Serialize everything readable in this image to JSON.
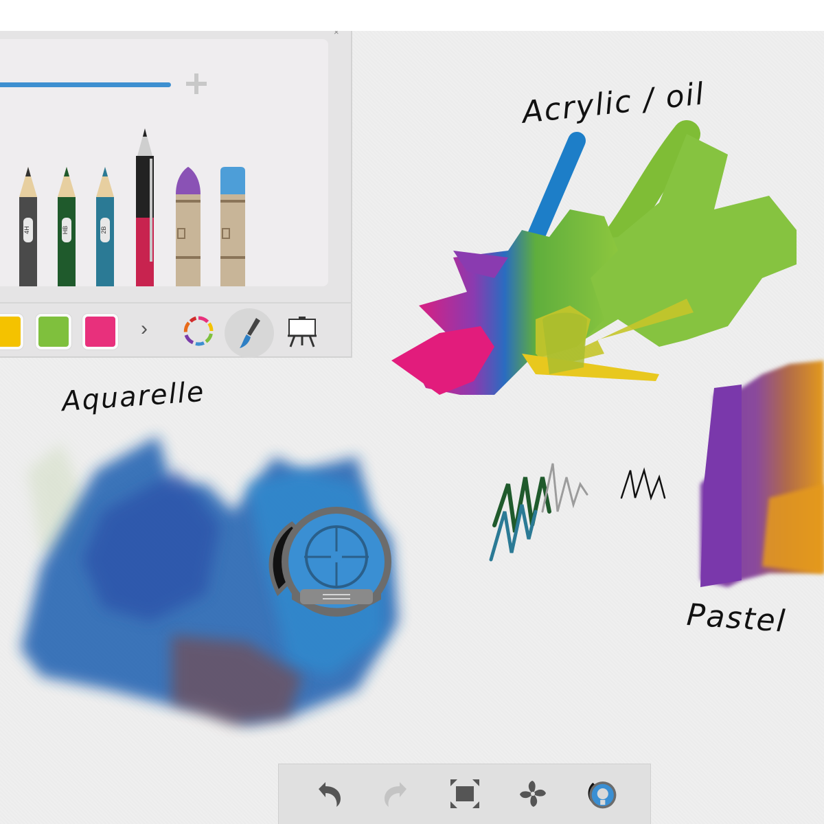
{
  "canvas": {
    "labels": {
      "acrylic_oil": "Acrylic / oil",
      "aquarelle": "Aquarelle",
      "pastel": "Pastel"
    }
  },
  "tool_panel": {
    "pencils": [
      {
        "name": "pencil-4h",
        "grade": "4H",
        "color": "#4a4a4a"
      },
      {
        "name": "pencil-hb",
        "grade": "HB",
        "color": "#1f5a2c"
      },
      {
        "name": "pencil-2b",
        "grade": "2B",
        "color": "#2b7a95"
      }
    ],
    "tools": [
      {
        "name": "pen",
        "icon": "ballpoint-pen-icon",
        "color": "#c8234f"
      },
      {
        "name": "crayon-purple",
        "icon": "crayon-icon",
        "color": "#8a52b5"
      },
      {
        "name": "crayon-blue",
        "icon": "crayon-icon",
        "color": "#4d9ed8"
      }
    ],
    "swatches": [
      {
        "name": "yellow",
        "color": "#f4c200"
      },
      {
        "name": "green",
        "color": "#7fc03d"
      },
      {
        "name": "pink",
        "color": "#e8307c"
      }
    ],
    "more_chevron": "›",
    "icons": {
      "color_wheel": "color-wheel-icon",
      "brush": "brush-icon",
      "easel": "easel-icon",
      "plus": "plus-icon",
      "close": "close-icon"
    },
    "close_glyph": "×",
    "stroke_width_color": "#3d8fd0"
  },
  "bottom_toolbar": {
    "buttons": [
      {
        "name": "undo",
        "icon": "undo-icon"
      },
      {
        "name": "redo",
        "icon": "redo-icon"
      },
      {
        "name": "fit-screen",
        "icon": "fit-screen-icon"
      },
      {
        "name": "fan",
        "icon": "fan-icon"
      },
      {
        "name": "ruler",
        "icon": "ruler-icon"
      }
    ]
  },
  "colors": {
    "accent_blue": "#3d8fd0",
    "canvas_bg": "#efefef"
  }
}
